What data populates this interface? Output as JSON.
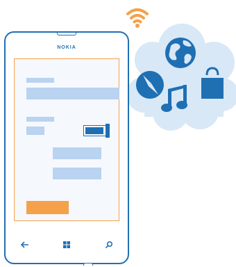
{
  "phone": {
    "brand": "NOKIA"
  },
  "navbar": {
    "back_icon": "back-arrow-icon",
    "start_icon": "windows-start-icon",
    "search_icon": "search-icon"
  },
  "cloud_icons": [
    "globe-icon",
    "compass-icon",
    "music-note-icon",
    "shopping-bag-icon"
  ],
  "colors": {
    "accent_blue": "#1f6fb3",
    "light_blue": "#b9d3f0",
    "cloud_blue": "#d8e8f7",
    "orange": "#f4a14a"
  }
}
